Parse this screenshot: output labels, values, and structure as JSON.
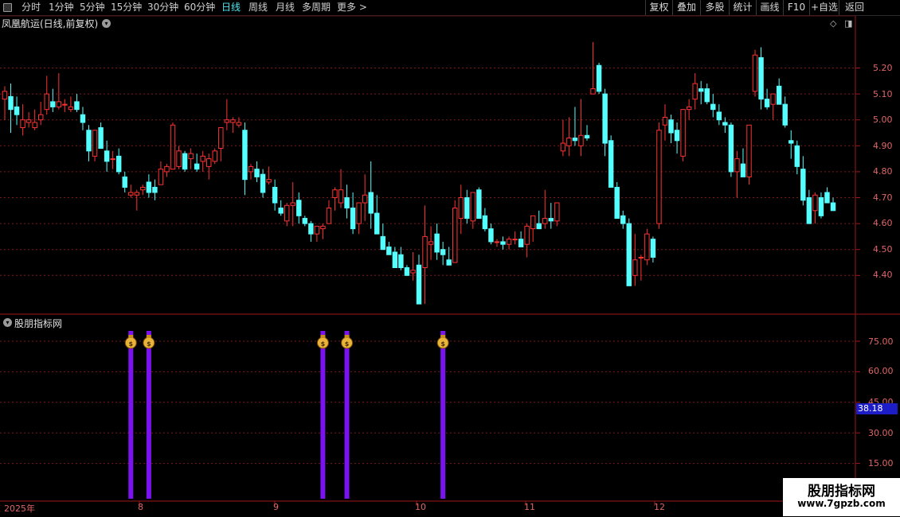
{
  "toolbar": {
    "menu_icon": "menu-icon",
    "periods": [
      "分时",
      "1分钟",
      "5分钟",
      "15分钟",
      "30分钟",
      "60分钟",
      "日线",
      "周线",
      "月线",
      "多周期"
    ],
    "active_period": "日线",
    "more_label": "更多 >",
    "right_buttons": [
      "复权",
      "叠加",
      "多股",
      "统计",
      "画线",
      "F10",
      "+自选",
      "返回"
    ]
  },
  "main_chart": {
    "title": "凤凰航运(日线,前复权)",
    "price_labels": [
      "5.20",
      "5.10",
      "5.00",
      "4.90",
      "4.80",
      "4.70",
      "4.60",
      "4.50",
      "4.40"
    ],
    "up_color": "#ff3232",
    "down_color": "#54ffff"
  },
  "indicator": {
    "title": "股朋指标网",
    "labels": [
      "75.00",
      "60.00",
      "45.00",
      "30.00",
      "15.00"
    ],
    "current_value": "38.18",
    "bar_color": "#7b12f0"
  },
  "x_axis": {
    "labels": [
      "2025年",
      "8",
      "9",
      "10",
      "11",
      "12"
    ]
  },
  "watermark": {
    "line1": "股朋指标网",
    "line2": "www.7gpzb.com"
  },
  "chart_data": {
    "type": "candlestick",
    "title": "凤凰航运(日线,前复权)",
    "y_range": [
      4.29,
      5.32
    ],
    "candles": [
      [
        5.08,
        5.13,
        5.0,
        5.11
      ],
      [
        5.09,
        5.14,
        4.95,
        5.04
      ],
      [
        5.05,
        5.09,
        4.98,
        5.02
      ],
      [
        4.97,
        5.06,
        4.94,
        5.0
      ],
      [
        4.99,
        5.03,
        4.97,
        5.0
      ],
      [
        4.97,
        5.04,
        4.96,
        4.99
      ],
      [
        5.0,
        5.07,
        4.98,
        5.02
      ],
      [
        5.04,
        5.17,
        5.02,
        5.1
      ],
      [
        5.07,
        5.12,
        5.03,
        5.05
      ],
      [
        5.05,
        5.18,
        5.04,
        5.07
      ],
      [
        5.06,
        5.08,
        5.03,
        5.06
      ],
      [
        5.04,
        5.09,
        5.03,
        5.05
      ],
      [
        5.07,
        5.1,
        5.03,
        5.04
      ],
      [
        5.02,
        5.05,
        4.96,
        4.99
      ],
      [
        4.96,
        4.98,
        4.84,
        4.88
      ],
      [
        4.86,
        4.94,
        4.84,
        4.96
      ],
      [
        4.97,
        4.99,
        4.89,
        4.89
      ],
      [
        4.88,
        4.92,
        4.8,
        4.84
      ],
      [
        4.85,
        4.88,
        4.81,
        4.85
      ],
      [
        4.86,
        4.89,
        4.79,
        4.8
      ],
      [
        4.78,
        4.8,
        4.72,
        4.74
      ],
      [
        4.71,
        4.75,
        4.7,
        4.72
      ],
      [
        4.71,
        4.73,
        4.65,
        4.72
      ],
      [
        4.73,
        4.75,
        4.71,
        4.74
      ],
      [
        4.76,
        4.79,
        4.7,
        4.72
      ],
      [
        4.74,
        4.77,
        4.69,
        4.72
      ],
      [
        4.75,
        4.84,
        4.75,
        4.81
      ],
      [
        4.8,
        4.83,
        4.78,
        4.82
      ],
      [
        4.81,
        4.99,
        4.81,
        4.98
      ],
      [
        4.82,
        4.9,
        4.81,
        4.88
      ],
      [
        4.87,
        4.88,
        4.8,
        4.81
      ],
      [
        4.85,
        4.89,
        4.81,
        4.87
      ],
      [
        4.83,
        4.87,
        4.8,
        4.81
      ],
      [
        4.84,
        4.88,
        4.8,
        4.86
      ],
      [
        4.82,
        4.87,
        4.77,
        4.85
      ],
      [
        4.84,
        4.89,
        4.83,
        4.88
      ],
      [
        4.89,
        4.95,
        4.84,
        4.97
      ],
      [
        4.99,
        5.08,
        4.96,
        5.0
      ],
      [
        4.99,
        5.01,
        4.95,
        5.0
      ],
      [
        4.98,
        5.01,
        4.97,
        4.99
      ],
      [
        4.96,
        4.99,
        4.71,
        4.77
      ],
      [
        4.8,
        4.83,
        4.77,
        4.82
      ],
      [
        4.81,
        4.84,
        4.76,
        4.78
      ],
      [
        4.79,
        4.81,
        4.7,
        4.72
      ],
      [
        4.76,
        4.82,
        4.75,
        4.77
      ],
      [
        4.74,
        4.77,
        4.65,
        4.68
      ],
      [
        4.66,
        4.69,
        4.63,
        4.64
      ],
      [
        4.61,
        4.68,
        4.59,
        4.67
      ],
      [
        4.67,
        4.76,
        4.59,
        4.68
      ],
      [
        4.69,
        4.72,
        4.6,
        4.63
      ],
      [
        4.62,
        4.63,
        4.59,
        4.6
      ],
      [
        4.6,
        4.61,
        4.53,
        4.56
      ],
      [
        4.56,
        4.59,
        4.53,
        4.59
      ],
      [
        4.58,
        4.6,
        4.54,
        4.59
      ],
      [
        4.6,
        4.69,
        4.6,
        4.66
      ],
      [
        4.7,
        4.74,
        4.65,
        4.73
      ],
      [
        4.68,
        4.81,
        4.66,
        4.73
      ],
      [
        4.7,
        4.75,
        4.62,
        4.66
      ],
      [
        4.66,
        4.72,
        4.56,
        4.58
      ],
      [
        4.6,
        4.68,
        4.56,
        4.68
      ],
      [
        4.68,
        4.79,
        4.61,
        4.71
      ],
      [
        4.72,
        4.84,
        4.58,
        4.64
      ],
      [
        4.64,
        4.71,
        4.56,
        4.56
      ],
      [
        4.55,
        4.6,
        4.53,
        4.5
      ],
      [
        4.51,
        4.53,
        4.49,
        4.48
      ],
      [
        4.49,
        4.51,
        4.44,
        4.43
      ],
      [
        4.48,
        4.51,
        4.42,
        4.43
      ],
      [
        4.43,
        4.44,
        4.4,
        4.4
      ],
      [
        4.41,
        4.49,
        4.38,
        4.42
      ],
      [
        4.44,
        4.48,
        4.29,
        4.29
      ],
      [
        4.43,
        4.67,
        4.29,
        4.55
      ],
      [
        4.52,
        4.59,
        4.46,
        4.53
      ],
      [
        4.56,
        4.6,
        4.46,
        4.49
      ],
      [
        4.5,
        4.53,
        4.44,
        4.48
      ],
      [
        4.46,
        4.51,
        4.44,
        4.44
      ],
      [
        4.45,
        4.69,
        4.45,
        4.66
      ],
      [
        4.62,
        4.75,
        4.56,
        4.7
      ],
      [
        4.7,
        4.73,
        4.6,
        4.62
      ],
      [
        4.61,
        4.72,
        4.58,
        4.72
      ],
      [
        4.73,
        4.74,
        4.62,
        4.62
      ],
      [
        4.63,
        4.66,
        4.57,
        4.58
      ],
      [
        4.58,
        4.6,
        4.52,
        4.53
      ],
      [
        4.53,
        4.54,
        4.51,
        4.53
      ],
      [
        4.53,
        4.55,
        4.5,
        4.52
      ],
      [
        4.52,
        4.55,
        4.5,
        4.54
      ],
      [
        4.54,
        4.57,
        4.52,
        4.54
      ],
      [
        4.54,
        4.57,
        4.52,
        4.51
      ],
      [
        4.52,
        4.6,
        4.47,
        4.59
      ],
      [
        4.58,
        4.61,
        4.53,
        4.63
      ],
      [
        4.6,
        4.65,
        4.58,
        4.58
      ],
      [
        4.6,
        4.73,
        4.58,
        4.62
      ],
      [
        4.62,
        4.68,
        4.58,
        4.61
      ],
      [
        4.61,
        4.63,
        4.59,
        4.68
      ],
      [
        4.88,
        5.0,
        4.86,
        4.91
      ],
      [
        4.9,
        5.01,
        4.86,
        4.93
      ],
      [
        4.93,
        5.05,
        4.9,
        4.92
      ],
      [
        4.9,
        5.08,
        4.86,
        4.94
      ],
      [
        4.94,
        4.98,
        4.92,
        4.93
      ],
      [
        5.1,
        5.3,
        5.1,
        5.12
      ],
      [
        5.21,
        5.22,
        5.1,
        5.11
      ],
      [
        5.1,
        5.12,
        4.86,
        4.91
      ],
      [
        4.92,
        4.94,
        4.75,
        4.74
      ],
      [
        4.74,
        4.76,
        4.68,
        4.62
      ],
      [
        4.63,
        4.65,
        4.58,
        4.6
      ],
      [
        4.6,
        4.62,
        4.4,
        4.36
      ],
      [
        4.4,
        4.56,
        4.36,
        4.46
      ],
      [
        4.47,
        4.48,
        4.38,
        4.47
      ],
      [
        4.46,
        4.58,
        4.44,
        4.56
      ],
      [
        4.54,
        4.55,
        4.45,
        4.47
      ],
      [
        4.6,
        4.99,
        4.58,
        4.96
      ],
      [
        4.98,
        5.06,
        4.92,
        5.01
      ],
      [
        5.0,
        5.02,
        4.91,
        4.95
      ],
      [
        4.96,
        4.99,
        4.87,
        4.92
      ],
      [
        4.86,
        5.02,
        4.84,
        5.04
      ],
      [
        5.04,
        5.08,
        5.0,
        5.05
      ],
      [
        5.08,
        5.18,
        5.04,
        5.14
      ],
      [
        5.12,
        5.15,
        5.06,
        5.11
      ],
      [
        5.12,
        5.14,
        5.06,
        5.07
      ],
      [
        5.06,
        5.1,
        5.01,
        5.04
      ],
      [
        5.03,
        5.06,
        4.98,
        5.0
      ],
      [
        4.99,
        5.01,
        4.95,
        4.98
      ],
      [
        4.98,
        4.99,
        4.78,
        4.8
      ],
      [
        4.8,
        4.88,
        4.7,
        4.85
      ],
      [
        4.83,
        4.89,
        4.78,
        4.78
      ],
      [
        4.78,
        4.82,
        4.75,
        4.98
      ],
      [
        5.11,
        5.27,
        5.09,
        5.25
      ],
      [
        5.24,
        5.28,
        5.04,
        5.08
      ],
      [
        5.08,
        5.12,
        5.04,
        5.05
      ],
      [
        5.06,
        5.09,
        5.0,
        5.1
      ],
      [
        5.13,
        5.16,
        5.08,
        5.06
      ],
      [
        5.06,
        5.09,
        4.97,
        4.98
      ],
      [
        4.92,
        4.96,
        4.85,
        4.91
      ],
      [
        4.9,
        4.92,
        4.79,
        4.82
      ],
      [
        4.81,
        4.86,
        4.67,
        4.69
      ],
      [
        4.7,
        4.73,
        4.62,
        4.6
      ],
      [
        4.65,
        4.72,
        4.6,
        4.71
      ],
      [
        4.7,
        4.72,
        4.62,
        4.63
      ],
      [
        4.72,
        4.74,
        4.69,
        4.68
      ],
      [
        4.68,
        4.7,
        4.65,
        4.65
      ]
    ],
    "indicator": {
      "ylim": [
        0,
        90
      ],
      "labels": [
        "75.00",
        "60.00",
        "45.00",
        "30.00",
        "15.00"
      ],
      "current_value": 38.18,
      "signals": [
        {
          "index": 21,
          "value": 82
        },
        {
          "index": 24,
          "value": 82
        },
        {
          "index": 53,
          "value": 82
        },
        {
          "index": 57,
          "value": 82
        },
        {
          "index": 73,
          "value": 82
        }
      ]
    }
  }
}
